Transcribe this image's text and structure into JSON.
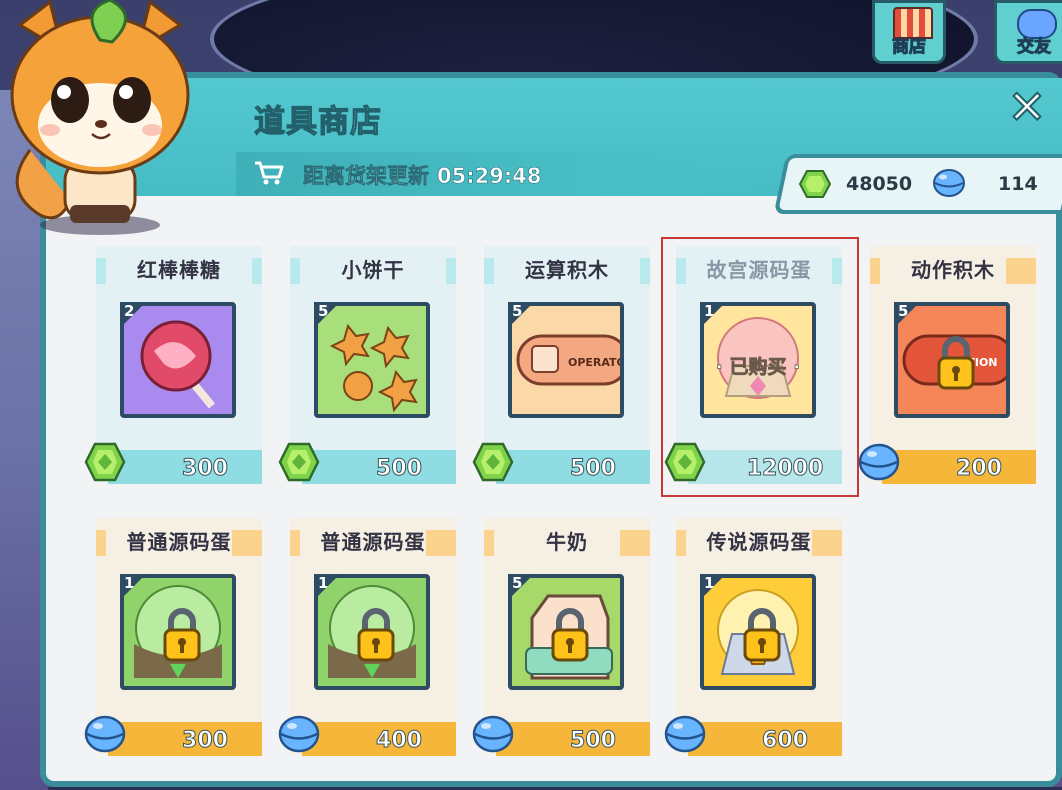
{
  "top_buttons": [
    {
      "label": "商店",
      "icon": "shop-icon"
    },
    {
      "label": "交友",
      "icon": "chat-icon"
    }
  ],
  "shop": {
    "title": "道具商店",
    "refresh_label": "距离货架更新",
    "refresh_time": "05:29:48",
    "close_icon": "close-icon",
    "close_symbol": "✕"
  },
  "currency": {
    "gems": "48050",
    "balls": "114"
  },
  "items": [
    {
      "name": "红棒棒糖",
      "qty": "2",
      "price": "300",
      "currency": "gem",
      "state": "available",
      "icon": "lollipop"
    },
    {
      "name": "小饼干",
      "qty": "5",
      "price": "500",
      "currency": "gem",
      "state": "available",
      "icon": "cookies"
    },
    {
      "name": "运算积木",
      "qty": "5",
      "price": "500",
      "currency": "gem",
      "state": "available",
      "icon": "operator-block"
    },
    {
      "name": "故宫源码蛋",
      "qty": "1",
      "price": "12000",
      "currency": "gem",
      "state": "bought",
      "bought_label": "· 已购买 ·",
      "icon": "palace-egg"
    },
    {
      "name": "动作积木",
      "qty": "5",
      "price": "200",
      "currency": "ball",
      "state": "locked",
      "icon": "motion-block"
    },
    {
      "name": "普通源码蛋",
      "qty": "1",
      "price": "300",
      "currency": "ball",
      "state": "locked",
      "icon": "green-egg"
    },
    {
      "name": "普通源码蛋",
      "qty": "1",
      "price": "400",
      "currency": "ball",
      "state": "locked",
      "icon": "green-egg"
    },
    {
      "name": "牛奶",
      "qty": "5",
      "price": "500",
      "currency": "ball",
      "state": "locked",
      "icon": "milk"
    },
    {
      "name": "传说源码蛋",
      "qty": "1",
      "price": "600",
      "currency": "ball",
      "state": "locked",
      "icon": "legend-egg"
    }
  ],
  "colors": {
    "accent": "#46bcc4",
    "border": "#3a8e9b",
    "gem": "#7fd34a",
    "ball": "#69b4ff",
    "locked_bar": "#f6b63a",
    "highlight": "#c83838"
  }
}
